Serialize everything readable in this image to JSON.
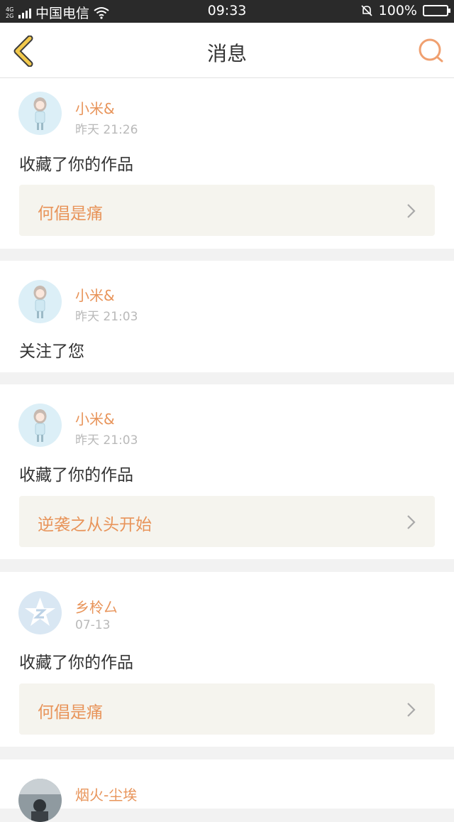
{
  "status_bar": {
    "network": "4G 2G",
    "carrier": "中国电信",
    "time": "09:33",
    "battery": "100%"
  },
  "header": {
    "title": "消息",
    "back_icon": "chevron-left-icon",
    "search_icon": "search-icon"
  },
  "colors": {
    "accent": "#e8945a",
    "back_icon": "#f2c94c",
    "work_box_bg": "#f5f4ee"
  },
  "messages": [
    {
      "user": "小米&",
      "time": "昨天 21:26",
      "action": "收藏了你的作品",
      "work": "何倡是痛",
      "avatar": "avatar-girl"
    },
    {
      "user": "小米&",
      "time": "昨天 21:03",
      "action": "关注了您",
      "work": null,
      "avatar": "avatar-girl"
    },
    {
      "user": "小米&",
      "time": "昨天 21:03",
      "action": "收藏了你的作品",
      "work": "逆袭之从头开始",
      "avatar": "avatar-girl"
    },
    {
      "user": "乡柃厶",
      "time": "07-13",
      "action": "收藏了你的作品",
      "work": "何倡是痛",
      "avatar": "avatar-default-qzone"
    },
    {
      "user": "烟火-尘埃",
      "time": "",
      "action": "",
      "work": null,
      "avatar": "avatar-photo"
    }
  ]
}
